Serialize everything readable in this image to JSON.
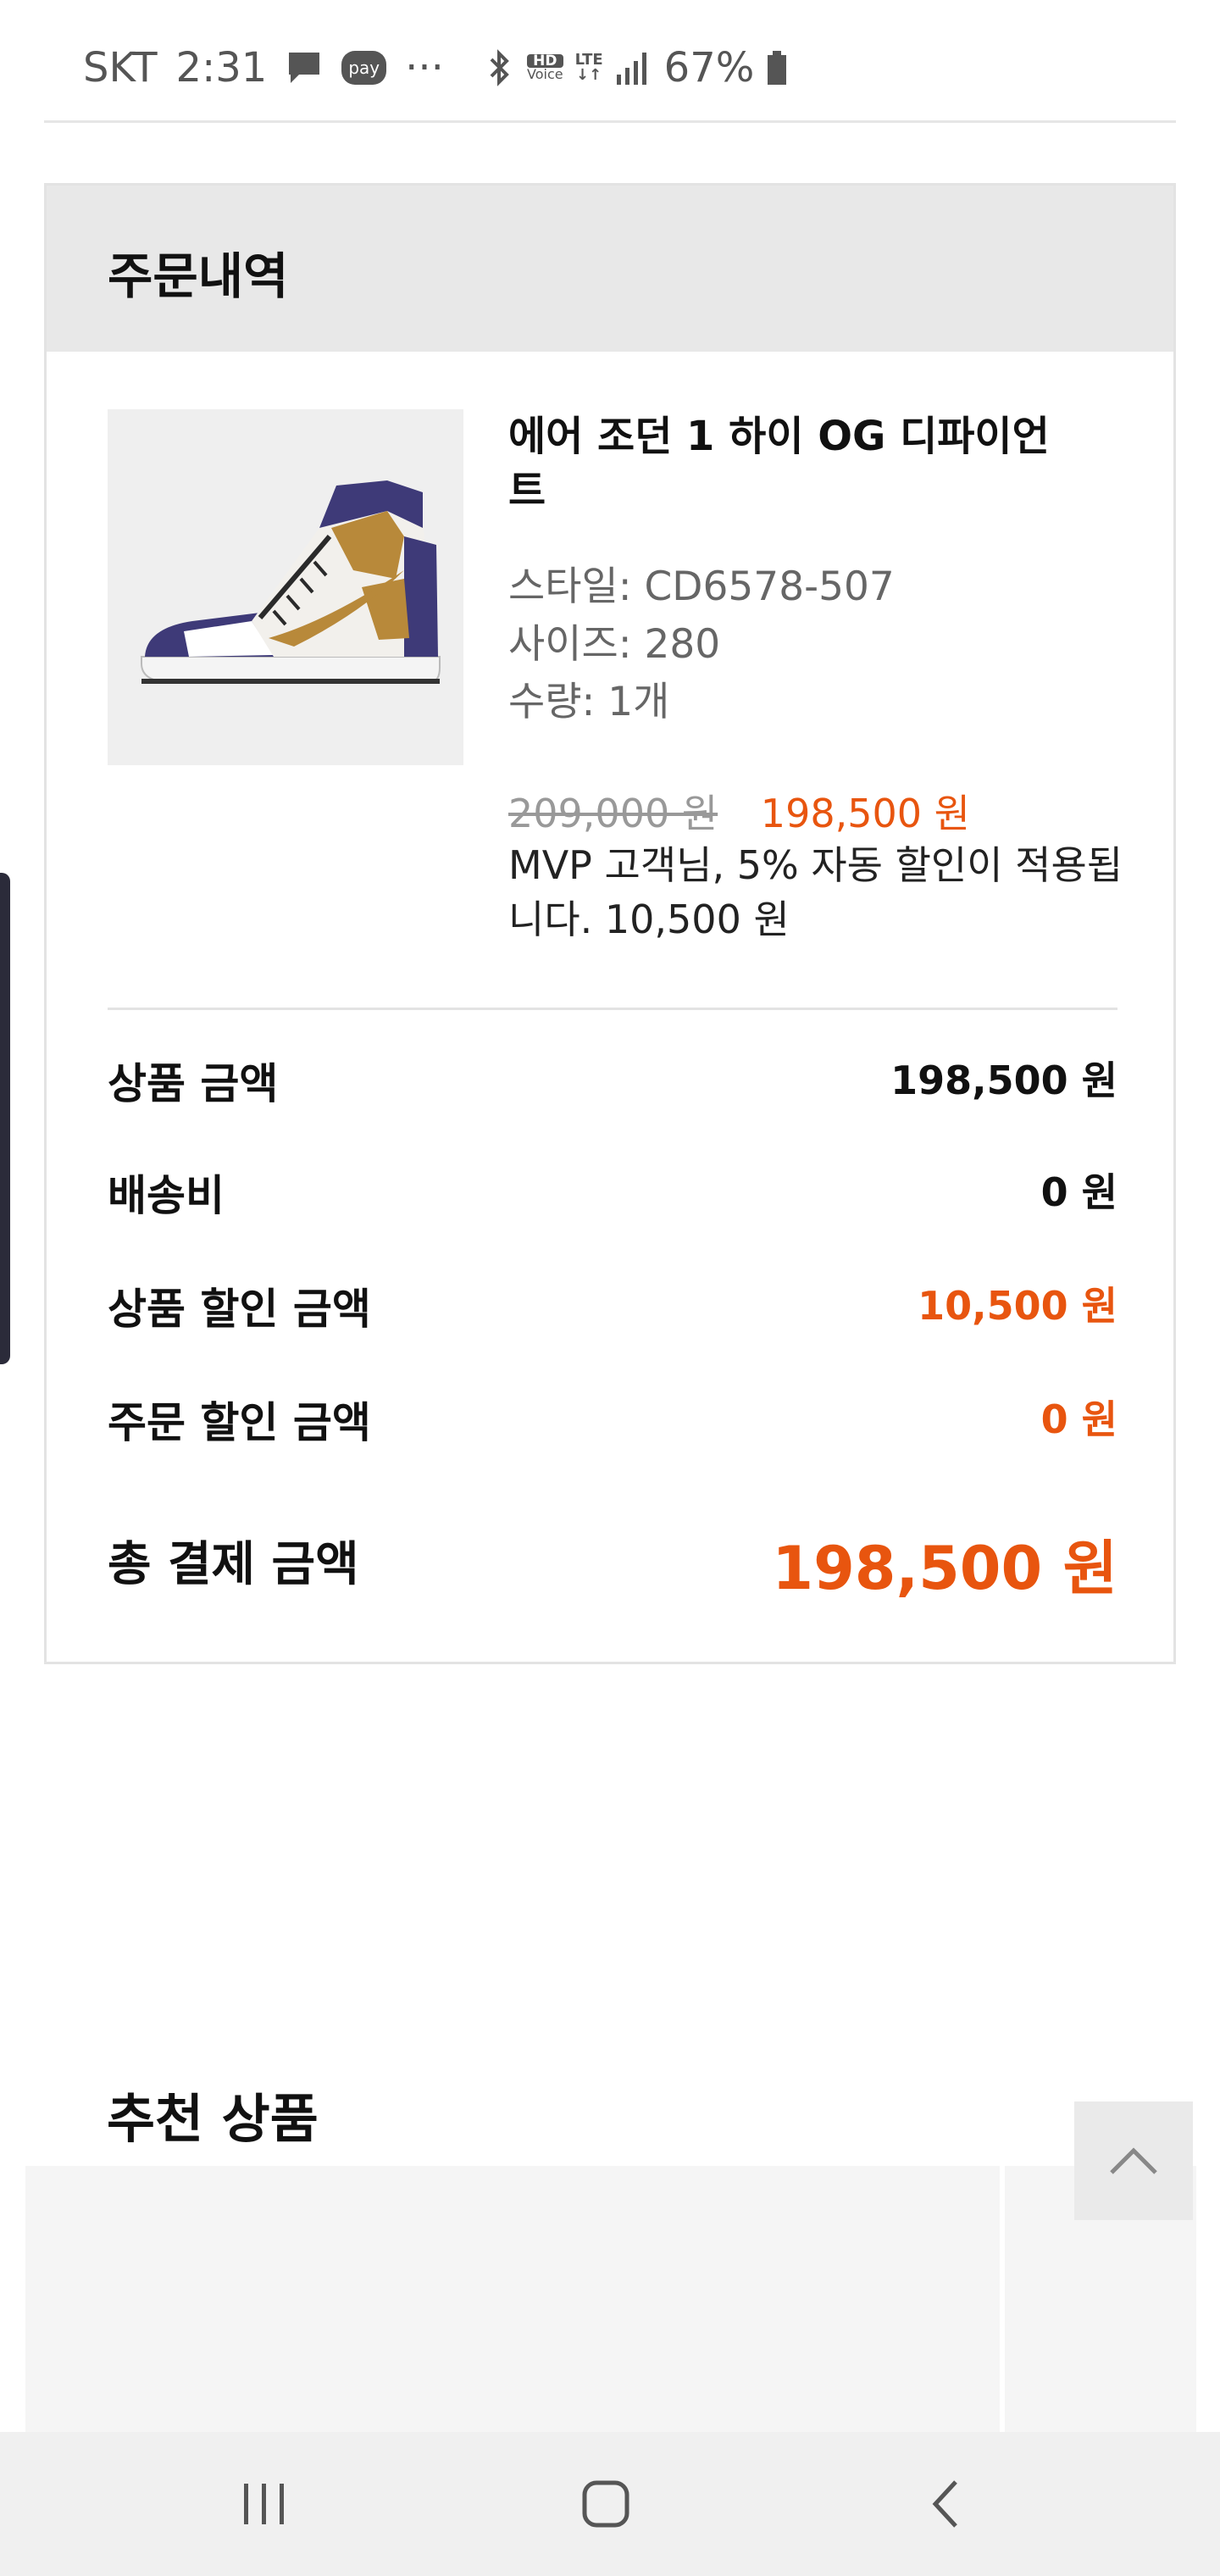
{
  "status_bar": {
    "carrier": "SKT",
    "time": "2:31",
    "pay_label": "pay",
    "more": "···",
    "hd_label": "HD",
    "voice_label": "Voice",
    "lte_label": "LTE",
    "battery": "67%"
  },
  "order": {
    "title": "주문내역",
    "product": {
      "name": "에어 조던 1 하이 OG 디파이언트",
      "style": "스타일: CD6578-507",
      "size": "사이즈: 280",
      "quantity": "수량: 1개",
      "original_price": "209,000 원",
      "sale_price": "198,500 원",
      "discount_note": "MVP 고객님, 5% 자동 할인이 적용됩니다. 10,500 원"
    },
    "summary": [
      {
        "label": "상품 금액",
        "value": "198,500 원"
      },
      {
        "label": "배송비",
        "value": "0 원"
      },
      {
        "label": "상품 할인 금액",
        "value": "10,500 원"
      },
      {
        "label": "주문 할인 금액",
        "value": "0 원"
      }
    ],
    "total": {
      "label": "총 결제 금액",
      "value": "198,500 원"
    }
  },
  "recommended": {
    "title": "추천 상품"
  },
  "colors": {
    "accent": "#e8550f",
    "header_bg": "#e8e8e8",
    "navbar_bg": "#f0f0f0"
  },
  "icons": {
    "chat": "chat-bubble-icon",
    "bluetooth": "bluetooth-icon",
    "signal": "signal-icon",
    "battery": "battery-icon",
    "scroll_top": "chevron-up-icon",
    "nav_recent": "recent-apps-icon",
    "nav_home": "home-icon",
    "nav_back": "back-icon"
  }
}
